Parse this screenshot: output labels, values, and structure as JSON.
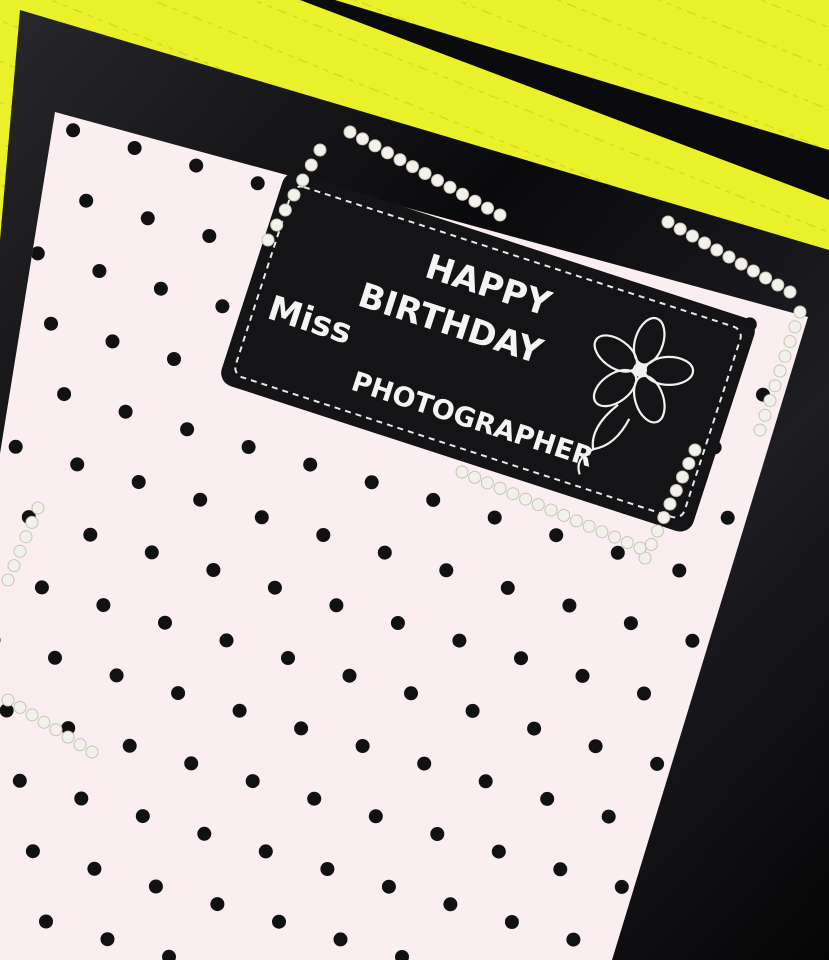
{
  "scene": {
    "background_color": "#eaf02a",
    "background_shadow": "#d6dc1e",
    "card_frame_color": "#0d0d0f",
    "card_paper_color": "#fbeef0",
    "dot_color": "#111111",
    "pearl_color": "#f3f1ec",
    "chalk_color": "#f4f4f4"
  },
  "label": {
    "line1": "HAPPY",
    "line2": "BIRTHDAY",
    "line3": "Miss",
    "line4": "PHOTOGRAPHER"
  },
  "decoration": {
    "flower_icon": "flower-icon",
    "border_style": "dashed-stitch"
  }
}
